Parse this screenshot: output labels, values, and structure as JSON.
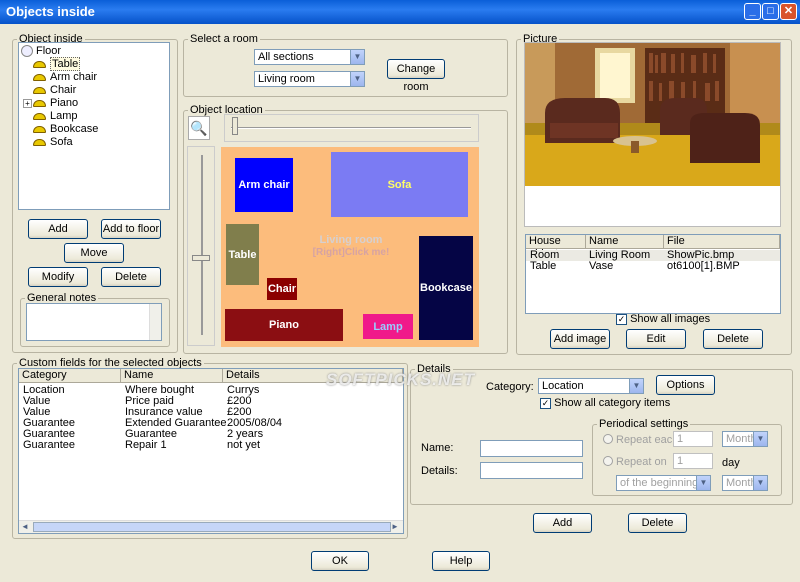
{
  "window": {
    "title": "Objects inside"
  },
  "objects_inside": {
    "legend": "Object inside",
    "root": "Floor",
    "items": [
      "Table",
      "Arm chair",
      "Chair",
      "Piano",
      "Lamp",
      "Bookcase",
      "Sofa"
    ],
    "buttons": {
      "add": "Add",
      "add_to_floor": "Add to floor",
      "move": "Move",
      "modify": "Modify",
      "delete": "Delete"
    },
    "notes_legend": "General notes"
  },
  "select_room": {
    "legend": "Select a room",
    "section": "All sections",
    "room": "Living room",
    "change_button": "Change room"
  },
  "object_location": {
    "legend": "Object location",
    "room_label": "Living room",
    "room_hint": "[Right]Click me!",
    "objects": {
      "arm_chair": "Arm chair",
      "sofa": "Sofa",
      "table": "Table",
      "chair": "Chair",
      "piano": "Piano",
      "lamp": "Lamp",
      "bookcase": "Bookcase"
    }
  },
  "picture": {
    "legend": "Picture",
    "columns": [
      "House object",
      "Name",
      "File"
    ],
    "rows": [
      [
        "Room",
        "Living Room",
        "ShowPic.bmp"
      ],
      [
        "Table",
        "Vase",
        "ot6100[1].BMP"
      ]
    ],
    "show_all": "Show all images",
    "buttons": {
      "add": "Add image",
      "edit": "Edit",
      "delete": "Delete"
    }
  },
  "custom_fields": {
    "legend": "Custom fields for the selected objects",
    "columns": [
      "Category",
      "Name",
      "Details"
    ],
    "rows": [
      [
        "Location",
        "Where bought",
        "Currys"
      ],
      [
        "Value",
        "Price paid",
        "£200"
      ],
      [
        "Value",
        "Insurance value",
        "£200"
      ],
      [
        "Guarantee",
        "Extended Guarantee",
        "2005/08/04"
      ],
      [
        "Guarantee",
        "Guarantee",
        "2 years"
      ],
      [
        "Guarantee",
        "Repair 1",
        "not yet"
      ]
    ]
  },
  "details": {
    "legend": "Details",
    "category_label": "Category:",
    "category_value": "Location",
    "options_button": "Options",
    "show_all_category": "Show all category items",
    "name_label": "Name:",
    "details_label": "Details:",
    "periodical": {
      "legend": "Periodical settings",
      "repeat_each": "Repeat each",
      "repeat_on": "Repeat on",
      "num1": "1",
      "unit1": "Month",
      "num2": "1",
      "day": "day",
      "beginning": "of the beginning of",
      "unit2": "Month"
    },
    "add_button": "Add",
    "delete_button": "Delete"
  },
  "watermark": "SOFTPICKS.NET",
  "footer": {
    "ok": "OK",
    "help": "Help"
  },
  "colors": {
    "room_floor": "#fcbc7c",
    "arm_chair": "#0000ff",
    "sofa": "#7b7bf3",
    "table": "#807e4c",
    "chair": "#8b0000",
    "piano": "#8b0e12",
    "lamp": "#f0198a",
    "bookcase": "#050545"
  }
}
